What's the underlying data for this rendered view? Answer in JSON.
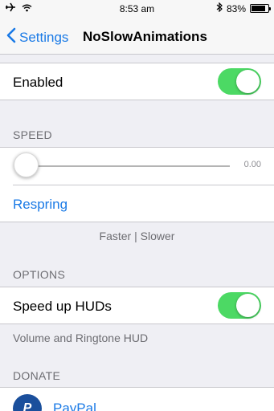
{
  "status_bar": {
    "time": "8:53 am",
    "battery": "83%",
    "battery_level": 0.83,
    "icons": [
      "airplane-icon",
      "wifi-icon",
      "bluetooth-icon",
      "battery-icon"
    ]
  },
  "nav": {
    "back_label": "Settings",
    "title": "NoSlowAnimations"
  },
  "enabled": {
    "label": "Enabled",
    "on": true
  },
  "speed": {
    "header": "SPEED",
    "value": "0.00",
    "level": 0.0,
    "respring_label": "Respring",
    "footer": "Faster | Slower"
  },
  "options": {
    "header": "OPTIONS",
    "speed_huds_label": "Speed up HUDs",
    "speed_huds_on": true,
    "footer": "Volume and Ringtone HUD"
  },
  "donate": {
    "header": "DONATE",
    "paypal_label": "PayPal",
    "paypal_icon_letter": "P"
  },
  "colors": {
    "accent": "#1a7ae6",
    "toggle_on": "#4cd964",
    "background": "#efeff4"
  }
}
